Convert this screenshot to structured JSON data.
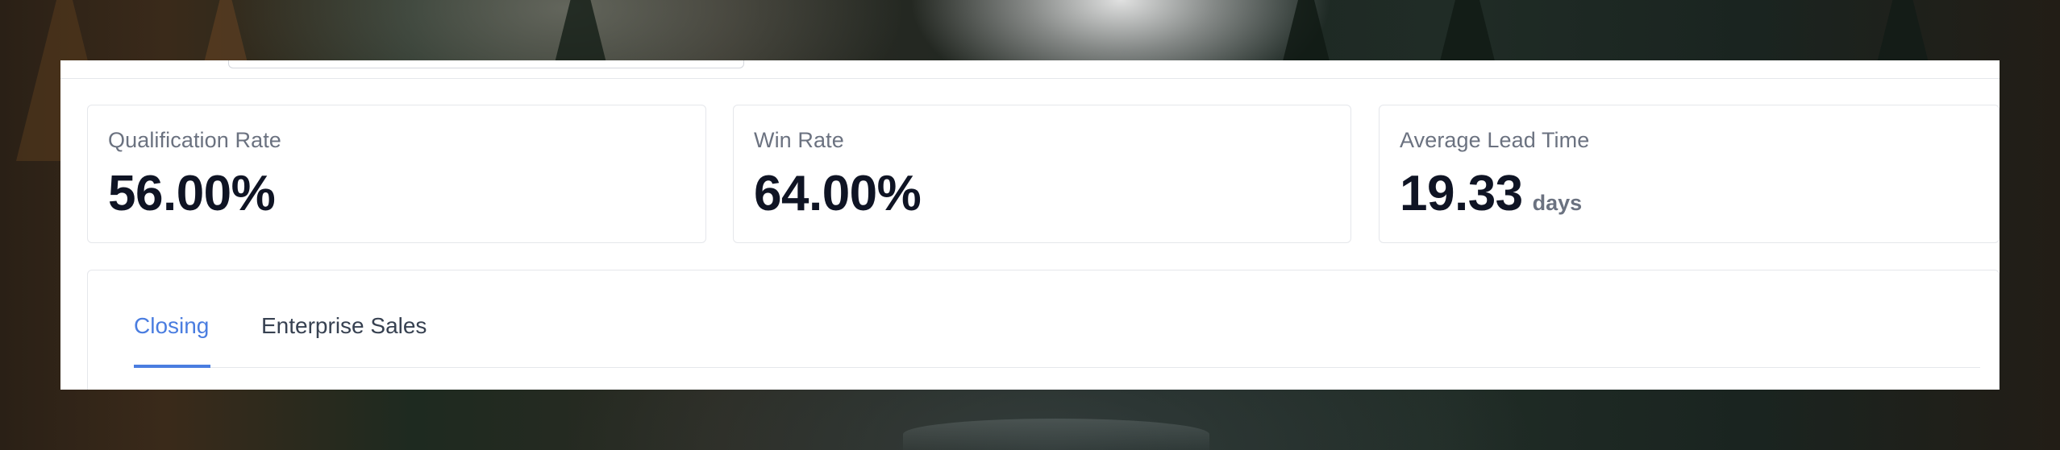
{
  "stats": [
    {
      "label": "Qualification Rate",
      "value": "56.00%",
      "unit": ""
    },
    {
      "label": "Win Rate",
      "value": "64.00%",
      "unit": ""
    },
    {
      "label": "Average Lead Time",
      "value": "19.33",
      "unit": "days"
    }
  ],
  "tabs": [
    {
      "label": "Closing",
      "active": true
    },
    {
      "label": "Enterprise Sales",
      "active": false
    }
  ],
  "colors": {
    "accent": "#4a7de0",
    "value_text": "#0f1424",
    "muted_text": "#6b7280",
    "border": "#e5e7eb"
  }
}
